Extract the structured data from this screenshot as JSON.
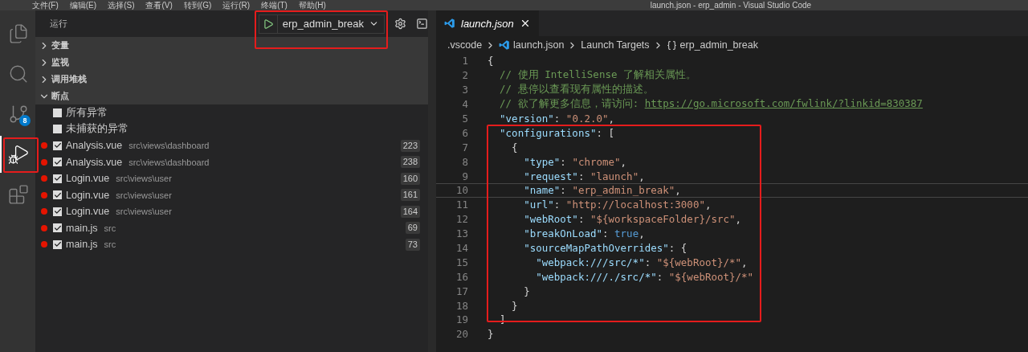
{
  "title_bar": {
    "menus": [
      "文件(F)",
      "编辑(E)",
      "选择(S)",
      "查看(V)",
      "转到(G)",
      "运行(R)",
      "终端(T)",
      "帮助(H)"
    ],
    "title": "launch.json - erp_admin - Visual Studio Code"
  },
  "activity_bar": {
    "items": [
      {
        "kind": "files",
        "selected": false
      },
      {
        "kind": "search",
        "selected": false
      },
      {
        "kind": "scm",
        "selected": false,
        "badge": "8"
      },
      {
        "kind": "debug",
        "selected": true
      },
      {
        "kind": "extensions",
        "selected": false
      }
    ]
  },
  "sidebar": {
    "title": "运行",
    "config": "erp_admin_break",
    "sections": [
      {
        "label": "变量",
        "expanded": false
      },
      {
        "label": "监视",
        "expanded": false
      },
      {
        "label": "调用堆栈",
        "expanded": false
      },
      {
        "label": "断点",
        "expanded": true
      }
    ],
    "exceptions": [
      {
        "label": "所有异常",
        "checked": false
      },
      {
        "label": "未捕获的异常",
        "checked": false
      }
    ],
    "breakpoints": [
      {
        "file": "Analysis.vue",
        "path": "src\\views\\dashboard",
        "line": "223",
        "checked": true
      },
      {
        "file": "Analysis.vue",
        "path": "src\\views\\dashboard",
        "line": "238",
        "checked": true
      },
      {
        "file": "Login.vue",
        "path": "src\\views\\user",
        "line": "160",
        "checked": true
      },
      {
        "file": "Login.vue",
        "path": "src\\views\\user",
        "line": "161",
        "checked": true
      },
      {
        "file": "Login.vue",
        "path": "src\\views\\user",
        "line": "164",
        "checked": true
      },
      {
        "file": "main.js",
        "path": "src",
        "line": "69",
        "checked": true
      },
      {
        "file": "main.js",
        "path": "src",
        "line": "73",
        "checked": true
      }
    ]
  },
  "editor": {
    "tab": {
      "label": "launch.json",
      "selected": true
    },
    "breadcrumb": [
      {
        "kind": "folder",
        "text": ".vscode"
      },
      {
        "kind": "file",
        "text": "launch.json"
      },
      {
        "kind": "plain",
        "text": "Launch Targets"
      },
      {
        "kind": "object",
        "text": "erp_admin_break"
      }
    ],
    "lines": [
      {
        "number": "1",
        "current": false,
        "tokens": [
          {
            "kind": "punct",
            "text": "{"
          }
        ]
      },
      {
        "number": "2",
        "current": false,
        "tokens": [
          {
            "kind": "comment",
            "text": "  // 使用 IntelliSense 了解相关属性。"
          }
        ]
      },
      {
        "number": "3",
        "current": false,
        "tokens": [
          {
            "kind": "comment",
            "text": "  // 悬停以查看现有属性的描述。"
          }
        ]
      },
      {
        "number": "4",
        "current": false,
        "tokens": [
          {
            "kind": "comment",
            "text": "  // 欲了解更多信息，请访问: "
          },
          {
            "kind": "link",
            "text": "https://go.microsoft.com/fwlink/?linkid=830387"
          }
        ]
      },
      {
        "number": "5",
        "current": false,
        "tokens": [
          {
            "kind": "key",
            "text": "  \"version\""
          },
          {
            "kind": "punct",
            "text": ": "
          },
          {
            "kind": "string",
            "text": "\"0.2.0\""
          },
          {
            "kind": "punct",
            "text": ","
          }
        ]
      },
      {
        "number": "6",
        "current": false,
        "tokens": [
          {
            "kind": "key",
            "text": "  \"configurations\""
          },
          {
            "kind": "punct",
            "text": ": ["
          }
        ]
      },
      {
        "number": "7",
        "current": false,
        "tokens": [
          {
            "kind": "punct",
            "text": "    {"
          }
        ]
      },
      {
        "number": "8",
        "current": false,
        "tokens": [
          {
            "kind": "key",
            "text": "      \"type\""
          },
          {
            "kind": "punct",
            "text": ": "
          },
          {
            "kind": "string",
            "text": "\"chrome\""
          },
          {
            "kind": "punct",
            "text": ","
          }
        ]
      },
      {
        "number": "9",
        "current": false,
        "tokens": [
          {
            "kind": "key",
            "text": "      \"request\""
          },
          {
            "kind": "punct",
            "text": ": "
          },
          {
            "kind": "string",
            "text": "\"launch\""
          },
          {
            "kind": "punct",
            "text": ","
          }
        ]
      },
      {
        "number": "10",
        "current": true,
        "tokens": [
          {
            "kind": "key",
            "text": "      \"name\""
          },
          {
            "kind": "punct",
            "text": ": "
          },
          {
            "kind": "string",
            "text": "\"erp_admin_break\""
          },
          {
            "kind": "punct",
            "text": ","
          }
        ]
      },
      {
        "number": "11",
        "current": false,
        "tokens": [
          {
            "kind": "key",
            "text": "      \"url\""
          },
          {
            "kind": "punct",
            "text": ": "
          },
          {
            "kind": "string",
            "text": "\"http://localhost:3000\""
          },
          {
            "kind": "punct",
            "text": ","
          }
        ]
      },
      {
        "number": "12",
        "current": false,
        "tokens": [
          {
            "kind": "key",
            "text": "      \"webRoot\""
          },
          {
            "kind": "punct",
            "text": ": "
          },
          {
            "kind": "string",
            "text": "\"${workspaceFolder}/src\""
          },
          {
            "kind": "punct",
            "text": ","
          }
        ]
      },
      {
        "number": "13",
        "current": false,
        "tokens": [
          {
            "kind": "key",
            "text": "      \"breakOnLoad\""
          },
          {
            "kind": "punct",
            "text": ": "
          },
          {
            "kind": "keyword",
            "text": "true"
          },
          {
            "kind": "punct",
            "text": ","
          }
        ]
      },
      {
        "number": "14",
        "current": false,
        "tokens": [
          {
            "kind": "key",
            "text": "      \"sourceMapPathOverrides\""
          },
          {
            "kind": "punct",
            "text": ": {"
          }
        ]
      },
      {
        "number": "15",
        "current": false,
        "tokens": [
          {
            "kind": "key",
            "text": "        \"webpack:///src/*\""
          },
          {
            "kind": "punct",
            "text": ": "
          },
          {
            "kind": "string",
            "text": "\"${webRoot}/*\""
          },
          {
            "kind": "punct",
            "text": ","
          }
        ]
      },
      {
        "number": "16",
        "current": false,
        "tokens": [
          {
            "kind": "key",
            "text": "        \"webpack:///./src/*\""
          },
          {
            "kind": "punct",
            "text": ": "
          },
          {
            "kind": "string",
            "text": "\"${webRoot}/*\""
          }
        ]
      },
      {
        "number": "17",
        "current": false,
        "tokens": [
          {
            "kind": "punct",
            "text": "      }"
          }
        ]
      },
      {
        "number": "18",
        "current": false,
        "tokens": [
          {
            "kind": "punct",
            "text": "    }"
          }
        ]
      },
      {
        "number": "19",
        "current": false,
        "tokens": [
          {
            "kind": "punct",
            "text": "  ]"
          }
        ]
      },
      {
        "number": "20",
        "current": false,
        "tokens": [
          {
            "kind": "punct",
            "text": "}"
          }
        ]
      }
    ]
  }
}
